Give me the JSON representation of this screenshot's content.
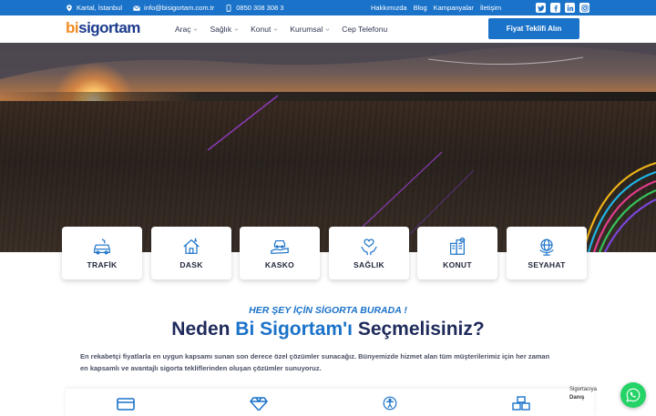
{
  "topbar": {
    "location": "Kartal, İstanbul",
    "email": "info@bisigortam.com.tr",
    "phone": "0850 308 308 3",
    "links": [
      "Hakkımızda",
      "Blog",
      "Kampanyalar",
      "İletişim"
    ],
    "social": [
      "twitter-icon",
      "facebook-icon",
      "linkedin-icon",
      "instagram-icon"
    ]
  },
  "header": {
    "logo_prefix": "bi",
    "logo_suffix": "sigortam",
    "nav": [
      {
        "label": "Araç",
        "has_dropdown": true
      },
      {
        "label": "Sağlık",
        "has_dropdown": true
      },
      {
        "label": "Konut",
        "has_dropdown": true
      },
      {
        "label": "Kurumsal",
        "has_dropdown": true
      },
      {
        "label": "Cep Telefonu",
        "has_dropdown": false
      }
    ],
    "cta_label": "Fiyat Teklifi Alın"
  },
  "categories": [
    {
      "label": "TRAFİK",
      "icon": "car-icon"
    },
    {
      "label": "DASK",
      "icon": "house-icon"
    },
    {
      "label": "KASKO",
      "icon": "car-hand-icon"
    },
    {
      "label": "SAĞLIK",
      "icon": "health-icon"
    },
    {
      "label": "KONUT",
      "icon": "building-icon"
    },
    {
      "label": "SEYAHAT",
      "icon": "globe-icon"
    }
  ],
  "why": {
    "kicker": "HER ŞEY İÇİN SİGORTA BURADA !",
    "title_before": "Neden ",
    "title_brand": "Bi Sigortam'ı",
    "title_after": " Seçmelisiniz?",
    "description": "En rekabetçi fiyatlarla en uygun kapsamı sunan son derece özel çözümler sunacağız. Bünyemizde hizmet alan tüm müşterilerimiz için her zaman en kapsamlı ve avantajlı sigorta tekliflerinden oluşan çözümler sunuyoruz."
  },
  "features_icons": [
    "card-icon",
    "diamond-icon",
    "accessibility-icon",
    "boxes-icon"
  ],
  "whatsapp": {
    "line1": "Sigortacıya",
    "line2": "Danış"
  },
  "colors": {
    "primary": "#1a72c9",
    "brand_orange": "#f28a1f",
    "navy": "#1e2a5a",
    "whatsapp": "#25d366"
  }
}
